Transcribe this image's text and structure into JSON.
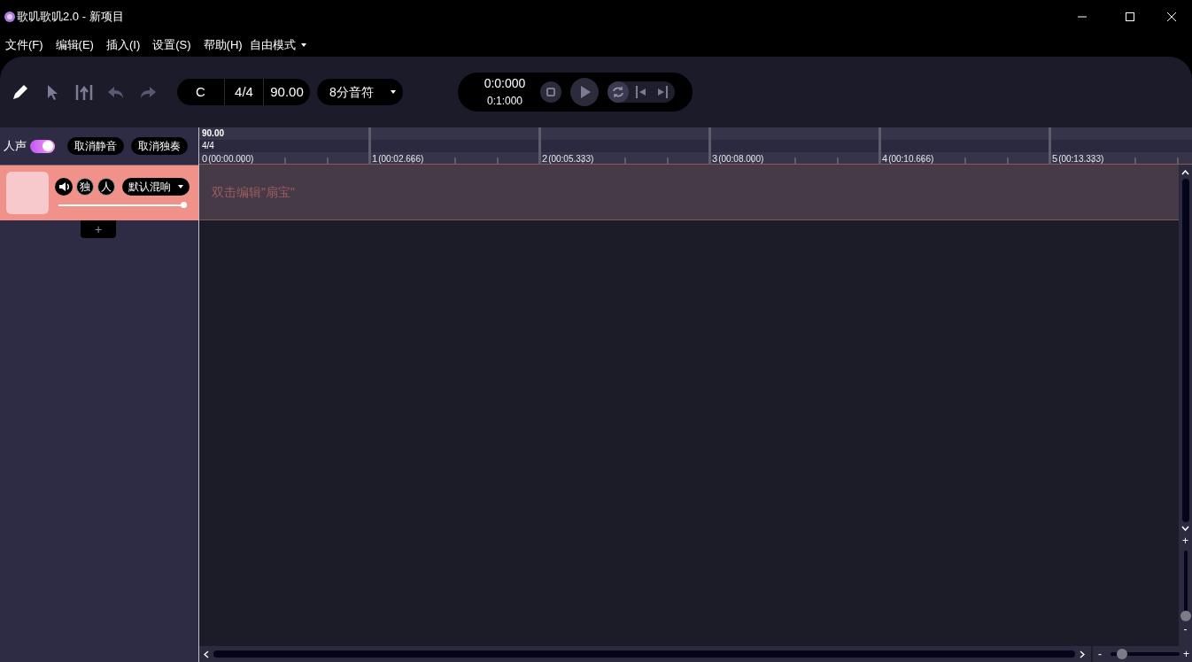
{
  "window": {
    "title": "歌叽歌叽2.0 - 新项目"
  },
  "menu": [
    "文件(F)",
    "编辑(E)",
    "插入(I)",
    "设置(S)",
    "帮助(H)"
  ],
  "mode_menu": {
    "label": "自由模式"
  },
  "tools": [
    {
      "kind": "pencil",
      "selected": true
    },
    {
      "kind": "pointer",
      "selected": false
    },
    {
      "kind": "split",
      "selected": false
    }
  ],
  "history": [
    {
      "kind": "undo",
      "disabled": true
    },
    {
      "kind": "redo",
      "disabled": true
    }
  ],
  "song": {
    "key": "C",
    "time_signature": "4/4",
    "tempo": "90.00",
    "note_length": "8分音符"
  },
  "transport": {
    "position": "0:0:000",
    "duration": "0:1:000",
    "loop": true
  },
  "track_header": {
    "label": "人声",
    "vocal_on": true,
    "unmute_all": "取消静音",
    "unsolo_all": "取消独奏"
  },
  "ruler": {
    "tempo": "90.00",
    "time_signature": "4/4",
    "measures": [
      {
        "number": "0",
        "time": "(00:00.000)"
      },
      {
        "number": "1",
        "time": "(00:02.666)"
      },
      {
        "number": "2",
        "time": "(00:05.333)"
      },
      {
        "number": "3",
        "time": "(00:08.000)"
      },
      {
        "number": "4",
        "time": "(00:10.666)"
      },
      {
        "number": "5",
        "time": "(00:13.333)"
      }
    ]
  },
  "tracks": [
    {
      "solo": "独",
      "vocal": "人",
      "muted": false,
      "reverb": "默认混响",
      "level": 1,
      "hint": "双击编辑\"扇宝\""
    }
  ],
  "add_track": "+",
  "vertical_zoom": {
    "plus": "+",
    "minus": "-",
    "level": 0
  },
  "horizontal_zoom": {
    "minus": "-",
    "plus": "+",
    "level": 0.1
  }
}
